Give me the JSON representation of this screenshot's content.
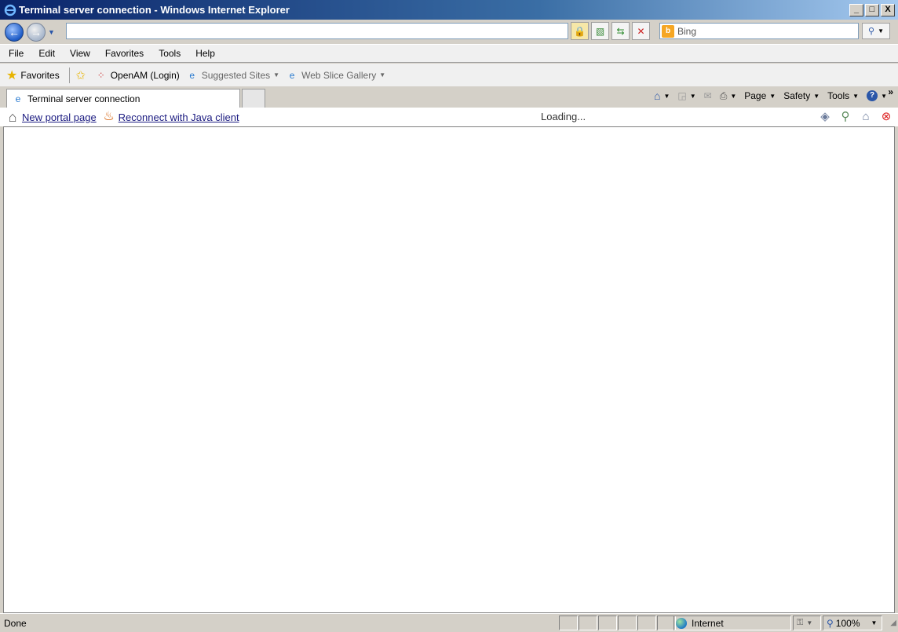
{
  "window": {
    "title": "Terminal server connection - Windows Internet Explorer",
    "controls": [
      "_",
      "□",
      "X"
    ]
  },
  "navigation": {
    "address_value": "",
    "search_placeholder": "Bing",
    "back_glyph": "←",
    "forward_glyph": "→"
  },
  "menu": {
    "items": [
      "File",
      "Edit",
      "View",
      "Favorites",
      "Tools",
      "Help"
    ]
  },
  "favorites_bar": {
    "favorites_label": "Favorites",
    "items": [
      "OpenAM (Login)",
      "Suggested Sites",
      "Web Slice Gallery"
    ]
  },
  "tabs": {
    "active": "Terminal server connection"
  },
  "command_bar": {
    "page": "Page",
    "safety": "Safety",
    "tools": "Tools",
    "help": "?"
  },
  "portal": {
    "new_portal_link": "New portal page",
    "reconnect_link": "Reconnect with Java client",
    "loading": "Loading..."
  },
  "status": {
    "text": "Done",
    "zone": "Internet",
    "zoom": "100%"
  }
}
